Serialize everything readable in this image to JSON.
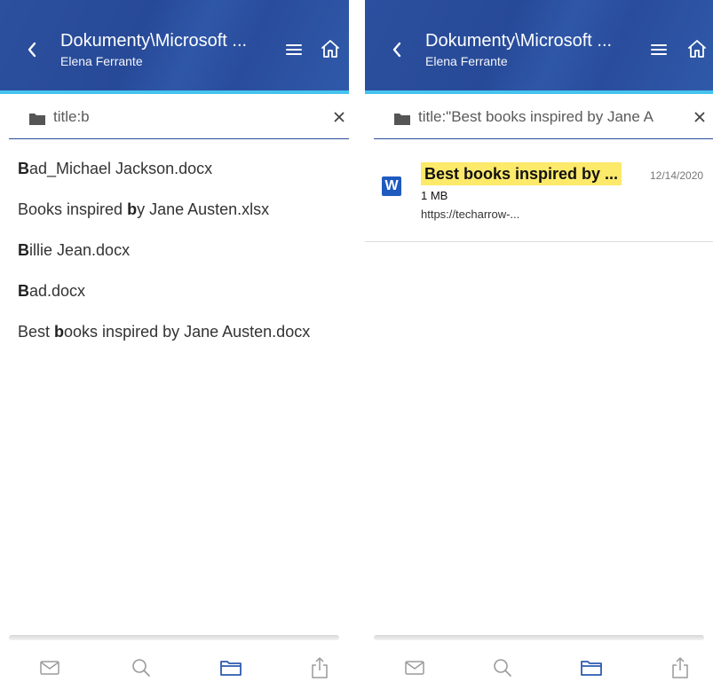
{
  "colors": {
    "header_bg": "#2c4f9e",
    "accent": "#45c3ee",
    "highlight": "#fde96a",
    "active_nav": "#2d5bb0",
    "inactive_nav": "#9a9a9a"
  },
  "left_panel": {
    "header": {
      "title": "Dokumenty\\Microsoft ...",
      "subtitle": "Elena Ferrante",
      "back_icon": "chevron-left-icon",
      "menu_icon": "hamburger-icon",
      "home_icon": "home-icon"
    },
    "search": {
      "folder_icon": "folder-icon",
      "query": "title:b",
      "clear_icon": "close-icon"
    },
    "suggestions": [
      {
        "bold": "B",
        "rest_before": "",
        "rest_after": "ad_Michael Jackson.docx"
      },
      {
        "bold": "b",
        "rest_before": "Books inspired ",
        "rest_after": "y Jane Austen.xlsx"
      },
      {
        "bold": "B",
        "rest_before": "",
        "rest_after": "illie Jean.docx"
      },
      {
        "bold": "B",
        "rest_before": "",
        "rest_after": "ad.docx"
      },
      {
        "bold": "b",
        "rest_before": "Best ",
        "rest_after": "ooks inspired by Jane Austen.docx"
      }
    ],
    "bottom_nav": {
      "items": [
        "mail-icon",
        "search-icon",
        "folder-icon",
        "share-icon"
      ],
      "active": "folder-icon"
    }
  },
  "right_panel": {
    "header": {
      "title": "Dokumenty\\Microsoft ...",
      "subtitle": "Elena Ferrante",
      "back_icon": "chevron-left-icon",
      "menu_icon": "hamburger-icon",
      "home_icon": "home-icon"
    },
    "search": {
      "folder_icon": "folder-icon",
      "query": "title:\"Best books inspired by Jane A",
      "clear_icon": "close-icon"
    },
    "result": {
      "file_icon": "word-icon",
      "file_icon_letter": "W",
      "title": "Best books inspired by ...",
      "date": "12/14/2020",
      "size": "1 MB",
      "url": "https://techarrow-..."
    },
    "bottom_nav": {
      "items": [
        "mail-icon",
        "search-icon",
        "folder-icon",
        "share-icon"
      ],
      "active": "folder-icon"
    }
  }
}
